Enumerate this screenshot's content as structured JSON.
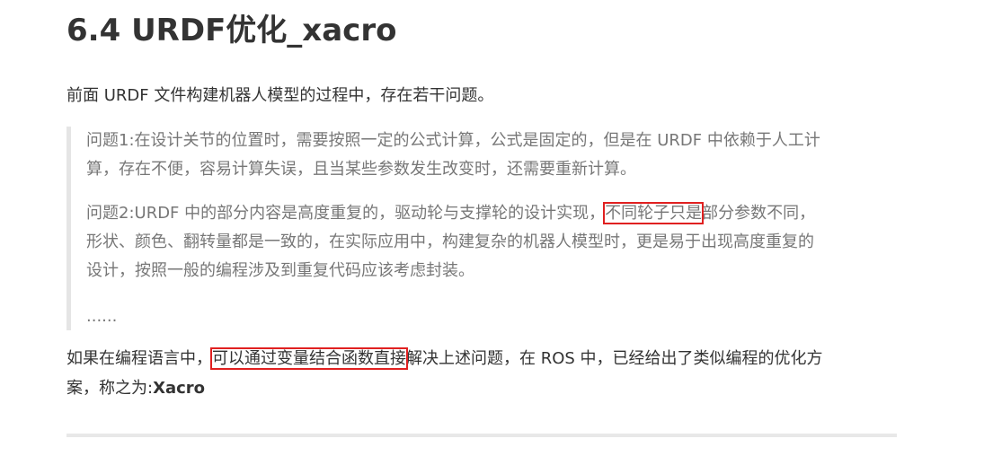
{
  "heading": "6.4 URDF优化_xacro",
  "intro": "前面 URDF 文件构建机器人模型的过程中，存在若干问题。",
  "quote": {
    "problem1_line1": "问题1:在设计关节的位置时，需要按照一定的公式计算，公式是固定的，但是在 URDF 中依赖于人工计",
    "problem1_line2": "算，存在不便，容易计算失误，且当某些参数发生改变时，还需要重新计算。",
    "problem2_line1_pre": "问题2:URDF 中的部分内容是高度重复的，驱动轮与支撑轮的设计实现，",
    "problem2_line1_highlight": "不同轮子只是",
    "problem2_line1_post": "部分参数不同，",
    "problem2_line2": "形状、颜色、翻转量都是一致的，在实际应用中，构建复杂的机器人模型时，更是易于出现高度重复的",
    "problem2_line3": "设计，按照一般的编程涉及到重复代码应该考虑封装。",
    "ellipsis": "......"
  },
  "conclusion": {
    "line1_pre": "如果在编程语言中，",
    "line1_highlight": "可以通过变量结合函数直接",
    "line1_post": "解决上述问题，在 ROS 中，已经给出了类似编程的优化方",
    "line2_pre": "案，称之为:",
    "line2_bold": "Xacro"
  },
  "colors": {
    "text": "#333333",
    "quote_text": "#777777",
    "quote_bar": "#e5e5e5",
    "highlight_border": "#e02020"
  }
}
